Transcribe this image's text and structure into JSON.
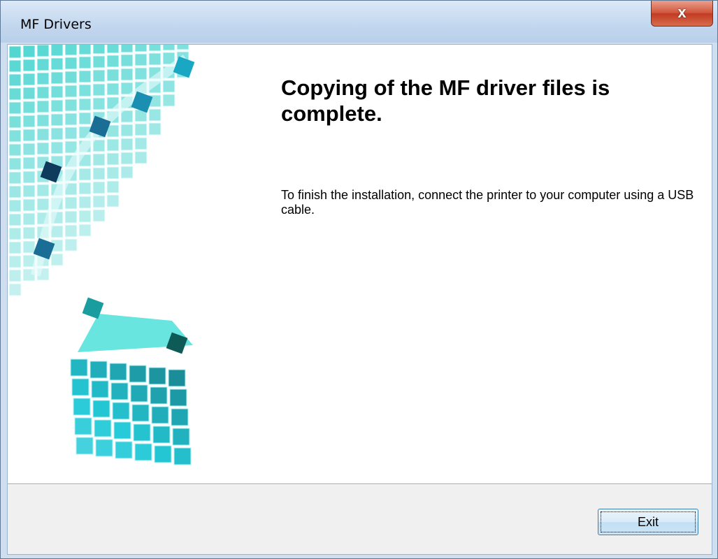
{
  "window": {
    "title": "MF Drivers"
  },
  "titlebar": {
    "close_label": "x"
  },
  "main": {
    "heading": "Copying of the MF driver files is complete.",
    "message": "To finish the installation, connect the printer to your computer using a USB cable."
  },
  "footer": {
    "exit_label": "Exit"
  },
  "colors": {
    "accent": "#1fc7c8",
    "titlebar": "#c4d8ef",
    "close_button": "#c13b22"
  },
  "icons": [
    "close-icon",
    "cube-graphic"
  ]
}
